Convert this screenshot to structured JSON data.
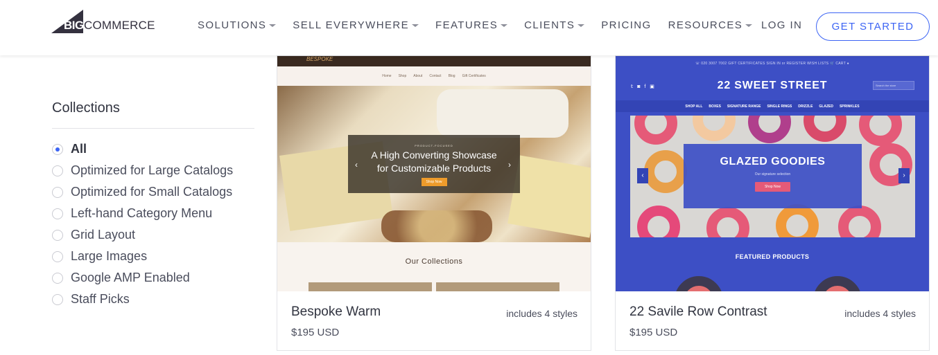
{
  "header": {
    "logo": {
      "big": "BIG",
      "commerce": "COMMERCE"
    },
    "nav": [
      {
        "label": "SOLUTIONS",
        "dropdown": true
      },
      {
        "label": "SELL EVERYWHERE",
        "dropdown": true
      },
      {
        "label": "FEATURES",
        "dropdown": true
      },
      {
        "label": "CLIENTS",
        "dropdown": true
      },
      {
        "label": "PRICING",
        "dropdown": false
      },
      {
        "label": "RESOURCES",
        "dropdown": true
      }
    ],
    "login": "LOG IN",
    "cta": "GET STARTED"
  },
  "sidebar": {
    "title": "Collections",
    "filters": [
      {
        "label": "All",
        "selected": true
      },
      {
        "label": "Optimized for Large Catalogs",
        "selected": false
      },
      {
        "label": "Optimized for Small Catalogs",
        "selected": false
      },
      {
        "label": "Left-hand Category Menu",
        "selected": false
      },
      {
        "label": "Grid Layout",
        "selected": false
      },
      {
        "label": "Large Images",
        "selected": false
      },
      {
        "label": "Google AMP Enabled",
        "selected": false
      },
      {
        "label": "Staff Picks",
        "selected": false
      }
    ]
  },
  "cards": [
    {
      "title": "Bespoke Warm",
      "styles": "includes 4 styles",
      "price": "$195 USD",
      "preview": {
        "brand": "BESPOKE",
        "nav": [
          "Home",
          "Shop",
          "About",
          "Contact",
          "Blog",
          "Gift Certificates"
        ],
        "kicker": "PRODUCT-FOCUSED",
        "headline_1": "A High Converting Showcase",
        "headline_2": "for Customizable Products",
        "button": "Shop Now",
        "section": "Our Collections"
      }
    },
    {
      "title": "22 Savile Row Contrast",
      "styles": "includes 4 styles",
      "price": "$195 USD",
      "preview": {
        "utility": "☏ 020 3007 7002     GIFT CERTIFICATES     SIGN IN or REGISTER     WISH LISTS     🛒 CART ●",
        "social": "𝕥 ◙ f ▣",
        "store_name": "22 SWEET STREET",
        "search_placeholder": "Search the store",
        "categories": [
          "SHOP ALL",
          "BOXES",
          "SIGNATURE RANGE",
          "SINGLE RINGS",
          "DRIZZLE",
          "GLAZED",
          "SPRINKLES"
        ],
        "hero_title": "GLAZED GOODIES",
        "hero_sub": "Our signature selection",
        "button": "Shop Now",
        "section": "FEATURED PRODUCTS"
      }
    }
  ],
  "colors": {
    "accent": "#3c64f4",
    "text": "#313440",
    "muted": "#4a4d5c"
  }
}
